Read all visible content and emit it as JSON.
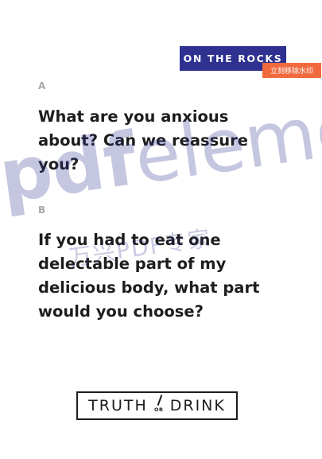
{
  "tag": {
    "label": "ON THE ROCKS"
  },
  "watermark": {
    "badge": "立刻移除水印",
    "brand_bold": "pdf",
    "brand_light": "eleme",
    "subtitle": "万兴PDF专家"
  },
  "cards": [
    {
      "letter": "A",
      "question": "What are you anxious about? Can we reassure you?"
    },
    {
      "letter": "B",
      "question": "If you had to eat one delectable part of my delicious body, what part would you choose?"
    }
  ],
  "logo": {
    "left": "TRUTH",
    "middle": "OR",
    "right": "DRINK"
  },
  "colors": {
    "tag_bg": "#2e3190",
    "badge_bg": "#f06a3e",
    "text": "#1d1d1d",
    "letter": "#a9a9a9"
  }
}
